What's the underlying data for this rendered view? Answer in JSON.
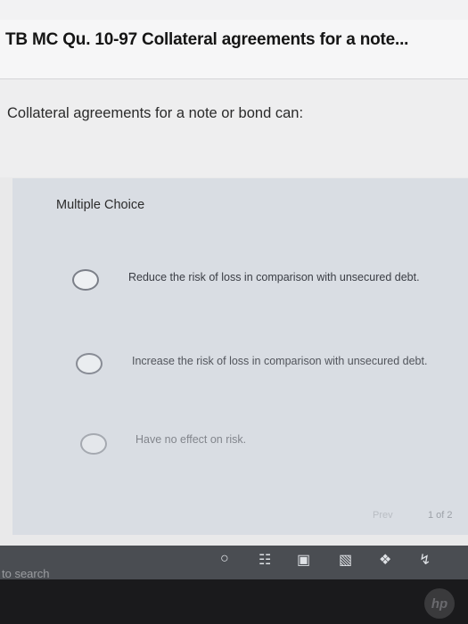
{
  "header": {
    "title": "TB MC Qu. 10-97 Collateral agreements for a note..."
  },
  "question": {
    "text": "Collateral agreements for a note or bond can:"
  },
  "multiple_choice": {
    "label": "Multiple Choice",
    "options": [
      {
        "label": "Reduce the risk of loss in comparison with unsecured debt."
      },
      {
        "label": "Increase the risk of loss in comparison with unsecured debt."
      },
      {
        "label": "Have no effect on risk."
      }
    ]
  },
  "footer": {
    "prev_label": "Prev",
    "page_indicator": "1 of 2"
  },
  "taskbar": {
    "search_text": "to search",
    "icons": [
      "cortana-icon",
      "task-view-icon",
      "store-icon",
      "shopping-bag-icon",
      "dropbox-icon",
      "app-icon"
    ]
  }
}
